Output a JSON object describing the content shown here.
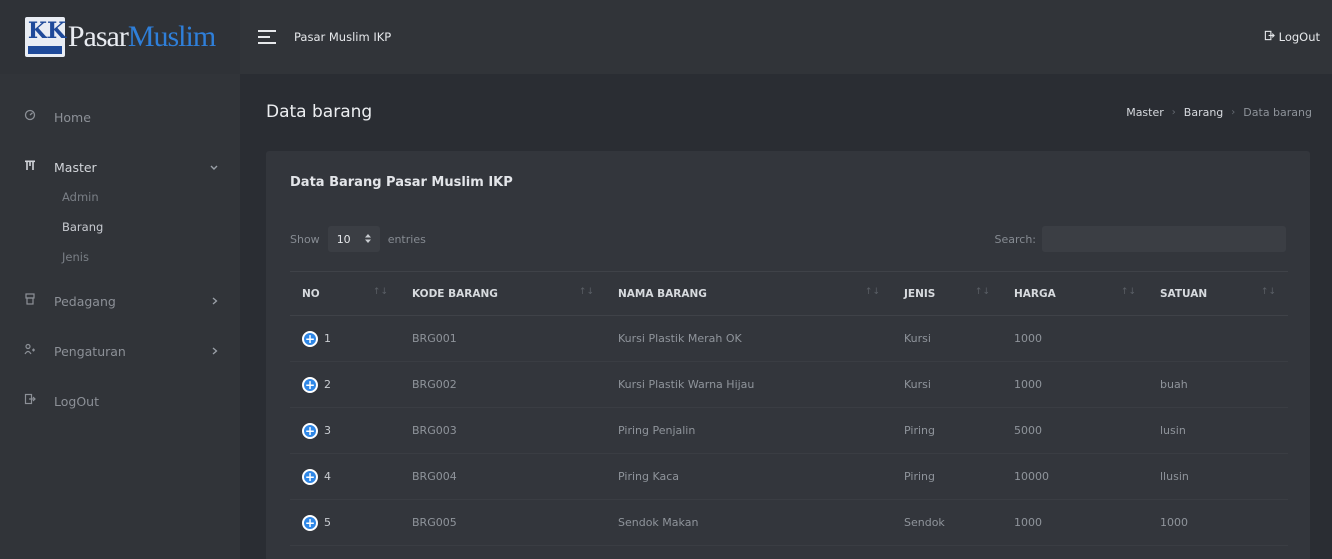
{
  "brand": {
    "logo_mark": "KK",
    "logo_text_1": "Pasar",
    "logo_text_2": "Muslim"
  },
  "topbar": {
    "title": "Pasar Muslim IKP",
    "logout_label": "LogOut"
  },
  "sidebar": {
    "items": [
      {
        "icon": "dashboard-icon",
        "label": "Home"
      },
      {
        "icon": "building-icon",
        "label": "Master",
        "submenu": [
          "Admin",
          "Barang",
          "Jenis"
        ],
        "active_sub": "Barang"
      },
      {
        "icon": "store-icon",
        "label": "Pedagang"
      },
      {
        "icon": "user-settings-icon",
        "label": "Pengaturan"
      },
      {
        "icon": "logout-icon",
        "label": "LogOut"
      }
    ]
  },
  "page": {
    "title": "Data barang",
    "breadcrumb": [
      "Master",
      "Barang",
      "Data barang"
    ]
  },
  "card": {
    "title": "Data Barang Pasar Muslim IKP",
    "show_label": "Show",
    "entries_value": "10",
    "entries_label": "entries",
    "search_label": "Search:",
    "search_value": ""
  },
  "table": {
    "columns": [
      "NO",
      "KODE BARANG",
      "NAMA BARANG",
      "JENIS",
      "HARGA",
      "SATUAN"
    ],
    "rows": [
      {
        "no": "1",
        "kode": "BRG001",
        "nama": "Kursi Plastik Merah OK",
        "jenis": "Kursi",
        "harga": "1000",
        "satuan": ""
      },
      {
        "no": "2",
        "kode": "BRG002",
        "nama": "Kursi Plastik Warna Hijau",
        "jenis": "Kursi",
        "harga": "1000",
        "satuan": "buah"
      },
      {
        "no": "3",
        "kode": "BRG003",
        "nama": "Piring Penjalin",
        "jenis": "Piring",
        "harga": "5000",
        "satuan": "lusin"
      },
      {
        "no": "4",
        "kode": "BRG004",
        "nama": "Piring Kaca",
        "jenis": "Piring",
        "harga": "10000",
        "satuan": "llusin"
      },
      {
        "no": "5",
        "kode": "BRG005",
        "nama": "Sendok Makan",
        "jenis": "Sendok",
        "harga": "1000",
        "satuan": "1000"
      }
    ]
  },
  "colors": {
    "accent": "#2f87e6",
    "background": "#2a2d33",
    "panel": "#313439",
    "card": "#33363c"
  }
}
